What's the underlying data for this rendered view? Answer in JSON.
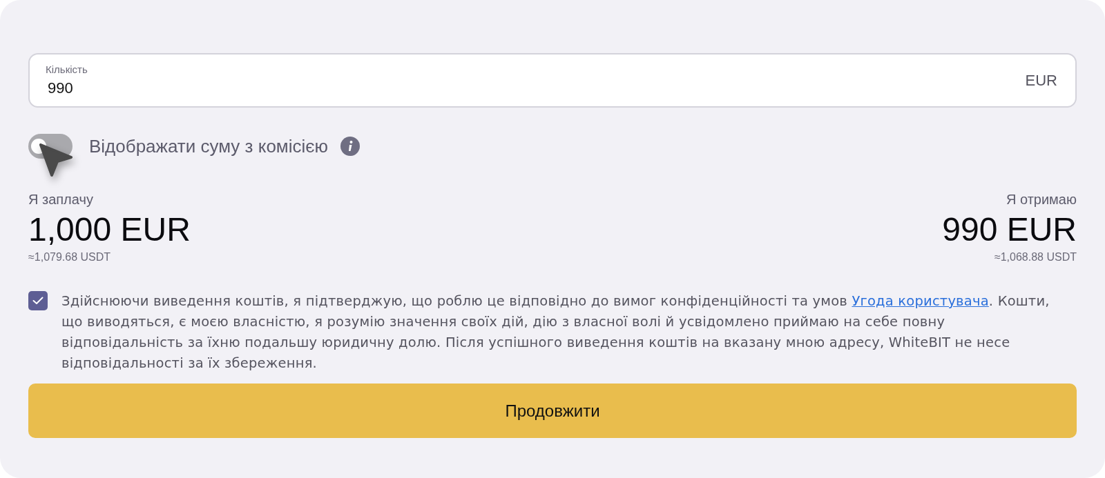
{
  "amount_field": {
    "label": "Кількість",
    "value": "990",
    "currency": "EUR"
  },
  "fee_toggle": {
    "label": "Відображати суму з комісією",
    "on": false
  },
  "pay": {
    "label": "Я заплачу",
    "amount": "1,000 EUR",
    "equivalent": "≈1,079.68 USDT"
  },
  "receive": {
    "label": "Я отримаю",
    "amount": "990 EUR",
    "equivalent": "≈1,068.88 USDT"
  },
  "consent": {
    "checked": true,
    "text_before": "Здійснюючи виведення коштів, я підтверджую, що роблю це відповідно до вимог конфіденційності та умов",
    "link": "Угода користувача",
    "text_after": ". Кошти, що виводяться, є моєю власністю, я розумію значення своїх дій, дію з власної волі й усвідомлено приймаю на себе повну відповідальність за їхню подальшу юридичну долю. Після успішного виведення коштів на вказану мною адресу, WhiteBIT не несе відповідальності за їх збереження."
  },
  "continue_button": {
    "label": "Продовжити"
  }
}
